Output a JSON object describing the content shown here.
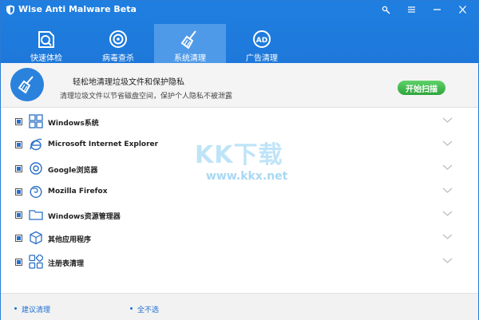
{
  "window": {
    "title": "Wise Anti Malware Beta"
  },
  "tabs": [
    {
      "label": "快速体检",
      "icon": "checkup-icon",
      "active": false
    },
    {
      "label": "病毒查杀",
      "icon": "virus-scan-icon",
      "active": false
    },
    {
      "label": "系统清理",
      "icon": "broom-icon",
      "active": true
    },
    {
      "label": "广告清理",
      "icon": "ad-block-icon",
      "active": false
    }
  ],
  "hero": {
    "title": "轻松地清理垃圾文件和保护隐私",
    "subtitle": "清理垃圾文件以节省磁盘空间，保护个人隐私不被泄露",
    "scan_button": "开始扫描"
  },
  "items": [
    {
      "label": "Windows系统",
      "icon": "windows-icon",
      "checked": true
    },
    {
      "label": "Microsoft Internet Explorer",
      "icon": "ie-icon",
      "checked": true
    },
    {
      "label": "Google浏览器",
      "icon": "chrome-icon",
      "checked": true
    },
    {
      "label": "Mozilla Firefox",
      "icon": "firefox-icon",
      "checked": true
    },
    {
      "label": "Windows资源管理器",
      "icon": "folder-icon",
      "checked": true
    },
    {
      "label": "其他应用程序",
      "icon": "box-icon",
      "checked": true
    },
    {
      "label": "注册表清理",
      "icon": "registry-icon",
      "checked": true
    }
  ],
  "watermark": {
    "main": "KK下载",
    "url": "www.kkx.net"
  },
  "footer": {
    "recommend": "建议清理",
    "none": "全不选"
  },
  "colors": {
    "accent": "#1e78da",
    "tab_active": "#4f9ae8",
    "scan_green": "#34b041",
    "link": "#1e6fd0"
  }
}
